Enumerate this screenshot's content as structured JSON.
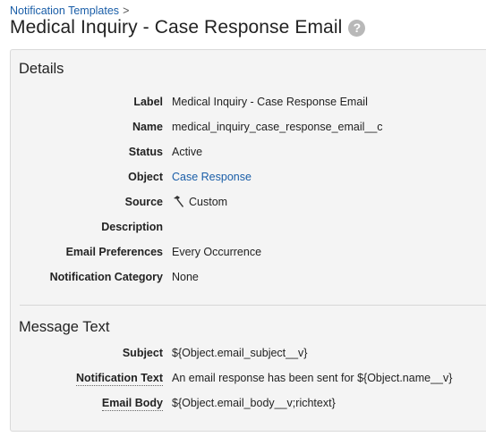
{
  "breadcrumb": {
    "parent": "Notification Templates",
    "separator": ">"
  },
  "header": {
    "title": "Medical Inquiry - Case Response Email",
    "help_icon": "?"
  },
  "details": {
    "heading": "Details",
    "fields": [
      {
        "label": "Label",
        "value": "Medical Inquiry - Case Response Email"
      },
      {
        "label": "Name",
        "value": "medical_inquiry_case_response_email__c"
      },
      {
        "label": "Status",
        "value": "Active"
      },
      {
        "label": "Object",
        "value": "Case Response",
        "link": true
      },
      {
        "label": "Source",
        "value": "Custom",
        "icon": "hammer-icon"
      },
      {
        "label": "Description",
        "value": ""
      },
      {
        "label": "Email Preferences",
        "value": "Every Occurrence"
      },
      {
        "label": "Notification Category",
        "value": "None"
      }
    ]
  },
  "message_text": {
    "heading": "Message Text",
    "fields": [
      {
        "label": "Subject",
        "value": "${Object.email_subject__v}"
      },
      {
        "label": "Notification Text",
        "value": "An email response has been sent for ${Object.name__v}"
      },
      {
        "label": "Email Body",
        "value": "${Object.email_body__v;richtext}"
      }
    ]
  },
  "colors": {
    "link": "#1a5ea8",
    "panel_bg": "#f4f4f4",
    "help_icon": "#b8b8b8"
  }
}
